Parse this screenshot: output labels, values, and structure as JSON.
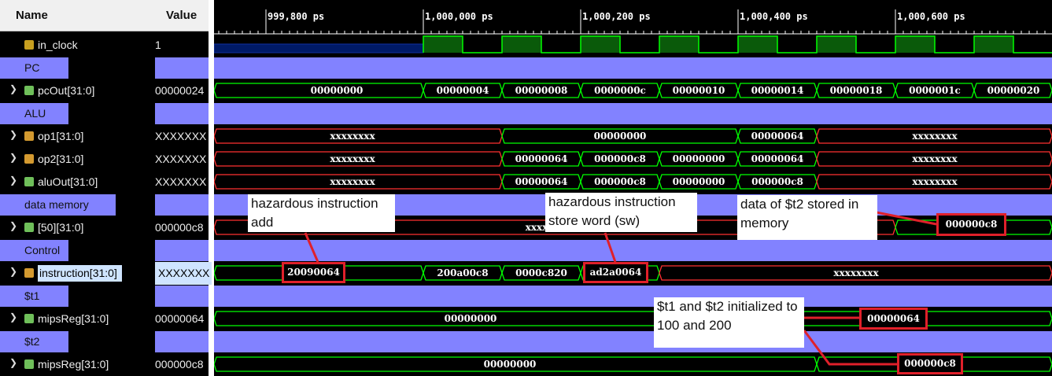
{
  "headers": {
    "name": "Name",
    "value": "Value"
  },
  "timeline": [
    "999,800 ps",
    "1,000,000 ps",
    "1,000,200 ps",
    "1,000,400 ps",
    "1,000,600 ps"
  ],
  "signals": [
    {
      "name": "in_clock",
      "value": "1",
      "kind": "clock"
    },
    {
      "name": "PC",
      "value": "",
      "kind": "divider"
    },
    {
      "name": "pcOut[31:0]",
      "value": "00000024",
      "kind": "bus",
      "segments": [
        "00000000",
        "00000004",
        "00000008",
        "0000000c",
        "00000010",
        "00000014",
        "00000018",
        "0000001c",
        "00000020"
      ]
    },
    {
      "name": "ALU",
      "value": "",
      "kind": "divider"
    },
    {
      "name": "op1[31:0]",
      "value": "XXXXXXX",
      "kind": "bus",
      "segments": [
        "xxxxxxxx",
        "00000000",
        "00000064",
        "xxxxxxxx"
      ]
    },
    {
      "name": "op2[31:0]",
      "value": "XXXXXXX",
      "kind": "bus",
      "segments": [
        "xxxxxxxx",
        "00000064",
        "000000c8",
        "00000000",
        "00000064",
        "xxxxxxxx"
      ]
    },
    {
      "name": "aluOut[31:0]",
      "value": "XXXXXXX",
      "kind": "bus",
      "segments": [
        "xxxxxxxx",
        "00000064",
        "000000c8",
        "00000000",
        "000000c8",
        "xxxxxxxx"
      ]
    },
    {
      "name": "data memory",
      "value": "",
      "kind": "divider"
    },
    {
      "name": "[50][31:0]",
      "value": "000000c8",
      "kind": "bus",
      "segments": [
        "xxxx",
        "000000c8"
      ]
    },
    {
      "name": "Control",
      "value": "",
      "kind": "divider"
    },
    {
      "name": "instruction[31:0]",
      "value": "XXXXXXX",
      "kind": "bus",
      "segments": [
        "20090064",
        "200a00c8",
        "0000c820",
        "ad2a0064",
        "xxxxxxxx"
      ]
    },
    {
      "name": "$t1",
      "value": "",
      "kind": "divider"
    },
    {
      "name": "mipsReg[31:0]",
      "value": "00000064",
      "kind": "bus",
      "segments": [
        "00000000",
        "00000064"
      ]
    },
    {
      "name": "$t2",
      "value": "",
      "kind": "divider"
    },
    {
      "name": "mipsReg[31:0]",
      "value": "000000c8",
      "kind": "bus",
      "segments": [
        "00000000",
        "000000c8"
      ]
    }
  ],
  "annotations": {
    "hazard_add": "hazardous instruction add",
    "hazard_sw": "hazardous instruction store word (sw)",
    "t2_stored": "data of $t2 stored in memory",
    "init": "$t1 and $t2 initialized to 100 and 200"
  },
  "colors": {
    "divider": "#8282ff",
    "clock": "#00ff00",
    "bus": "#00ff00",
    "xbus": "#ff3030",
    "callout_border": "#e0202a"
  }
}
